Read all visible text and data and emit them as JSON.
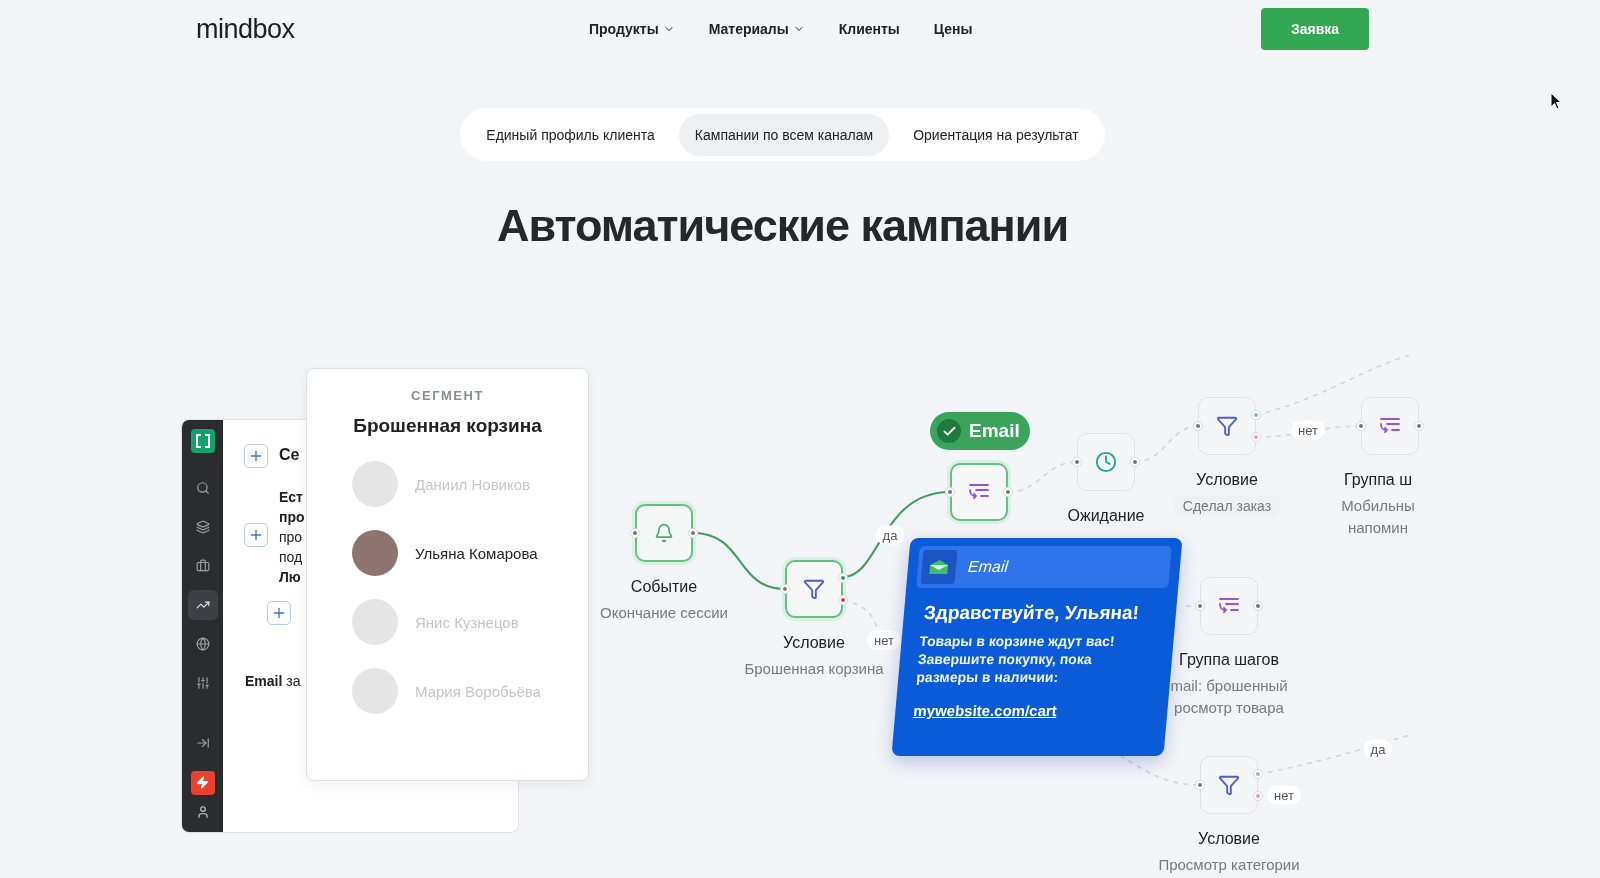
{
  "header": {
    "logo": "mindbox",
    "nav": [
      {
        "label": "Продукты",
        "dropdown": true
      },
      {
        "label": "Материалы",
        "dropdown": true
      },
      {
        "label": "Клиенты",
        "dropdown": false
      },
      {
        "label": "Цены",
        "dropdown": false
      }
    ],
    "cta": "Заявка"
  },
  "tabs": [
    {
      "label": "Единый профиль клиента",
      "selected": false
    },
    {
      "label": "Кампании по всем каналам",
      "selected": true
    },
    {
      "label": "Ориентация на результат",
      "selected": false
    }
  ],
  "heading": "Автоматические кампании",
  "app_panel": {
    "sidebar": [
      {
        "selected": false
      },
      {
        "selected": false
      },
      {
        "selected": false
      },
      {
        "selected": true
      },
      {
        "selected": false
      },
      {
        "selected": false
      },
      {
        "selected": false
      }
    ],
    "first_row": "Се",
    "lines": [
      {
        "text": "Ест",
        "bold": true
      },
      {
        "text": "про",
        "bold": true
      },
      {
        "text": "про",
        "bold": false
      },
      {
        "text": "под",
        "bold": false
      },
      {
        "text": "Лю",
        "bold": true
      }
    ],
    "last_row": "**Email** за"
  },
  "segment": {
    "label": "СЕГМЕНТ",
    "title": "Брошенная корзина",
    "people": [
      {
        "name": "Даниил Новиков",
        "selected": false
      },
      {
        "name": "Ульяна Комарова",
        "selected": true
      },
      {
        "name": "Янис Кузнецов",
        "selected": false
      },
      {
        "name": "Мария Воробьёва",
        "selected": false
      }
    ]
  },
  "nodes": [
    {
      "kind": "event",
      "active": true,
      "title": "Событие",
      "subtitle": "Окончание сессии"
    },
    {
      "kind": "condition",
      "active": true,
      "title": "Условие",
      "subtitle": "Брошенная корзина"
    },
    {
      "kind": "group",
      "active": true,
      "badge": "Email"
    },
    {
      "kind": "wait",
      "active": false,
      "title": "Ожидание"
    },
    {
      "kind": "condition",
      "active": false,
      "title": "Условие",
      "subtitle": "Сделал заказ",
      "pill": true
    },
    {
      "kind": "group",
      "active": false,
      "title": "Группа ш",
      "subtitle": "Мобильны\nнапомин"
    },
    {
      "kind": "group",
      "active": false,
      "title": "Группа шагов",
      "subtitle": "mail: брошенный\nросмотр товара"
    },
    {
      "kind": "condition",
      "active": false,
      "title": "Условие",
      "subtitle": "Просмотр категории"
    }
  ],
  "edge_labels": [
    "да",
    "нет",
    "нет",
    "да",
    "нет"
  ],
  "email_card": {
    "header": "Email",
    "greeting": "Здравствуйте, Ульяна!",
    "body": "Товары в корзине ждут вас! Завершите покупку, пока размеры в наличии:",
    "link": "mywebsite.com/cart"
  }
}
